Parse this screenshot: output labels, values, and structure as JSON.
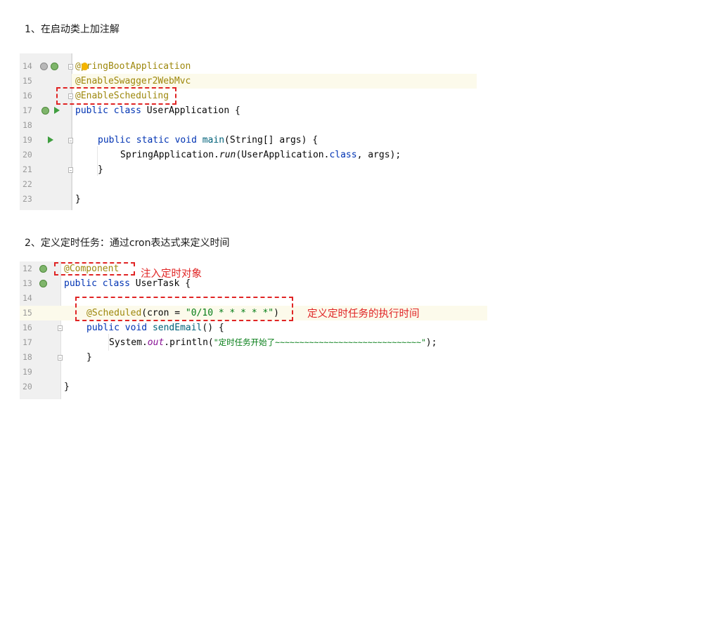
{
  "headings": {
    "step1": "1、在启动类上加注解",
    "step2": "2、定义定时任务：通过cron表达式来定义时间"
  },
  "block1": {
    "lines": [
      {
        "num": "14",
        "text": "@SpringBootApplication"
      },
      {
        "num": "15",
        "text": "@EnableSwagger2WebMvc"
      },
      {
        "num": "16",
        "text": "@EnableScheduling"
      },
      {
        "num": "17",
        "text": "public class UserApplication {"
      },
      {
        "num": "18",
        "text": ""
      },
      {
        "num": "19",
        "text": "    public static void main(String[] args) {"
      },
      {
        "num": "20",
        "text": "        SpringApplication.run(UserApplication.class, args);"
      },
      {
        "num": "21",
        "text": "    }"
      },
      {
        "num": "22",
        "text": ""
      },
      {
        "num": "23",
        "text": "}"
      }
    ],
    "tokens": {
      "a14_at": "@",
      "a14_rest": "pringBootApplication",
      "a15": "@EnableSwagger2WebMvc",
      "a16": "@EnableScheduling",
      "l17_kw1": "public",
      "l17_kw2": "class",
      "l17_rest": "UserApplication {",
      "l19_kw1": "public",
      "l19_kw2": "static",
      "l19_kw3": "void",
      "l19_fn": "main",
      "l19_rest": "(String[] args) {",
      "l20_a": "SpringApplication.",
      "l20_run": "run",
      "l20_b": "(UserApplication.",
      "l20_class": "class",
      "l20_c": ", args);",
      "l21": "}",
      "l23": "}"
    }
  },
  "block2": {
    "lines": [
      {
        "num": "12"
      },
      {
        "num": "13"
      },
      {
        "num": "14"
      },
      {
        "num": "15"
      },
      {
        "num": "16"
      },
      {
        "num": "17"
      },
      {
        "num": "18"
      },
      {
        "num": "19"
      },
      {
        "num": "20"
      }
    ],
    "tokens": {
      "a12": "@Component",
      "l13_kw1": "public",
      "l13_kw2": "class",
      "l13_rest": "UserTask {",
      "a15": "@Scheduled",
      "l15_a": "(cron = ",
      "l15_str": "\"0/10 * * * * *\"",
      "l15_b": ")",
      "l16_kw1": "public",
      "l16_kw2": "void",
      "l16_fn": "sendEmail",
      "l16_rest": "() {",
      "l17_a": "System.",
      "l17_out": "out",
      "l17_b": ".println(",
      "l17_str": "\"定时任务开始了~~~~~~~~~~~~~~~~~~~~~~~~~~~~~~\"",
      "l17_c": ");",
      "l18": "}",
      "l20": "}"
    },
    "annotations": {
      "inject_label": "注入定时对象",
      "schedule_label": "定义定时任务的执行时间"
    }
  },
  "colors": {
    "keyword": "#0033b3",
    "annotation": "#9e880d",
    "string": "#067d17",
    "highlight_box": "#e02424"
  }
}
